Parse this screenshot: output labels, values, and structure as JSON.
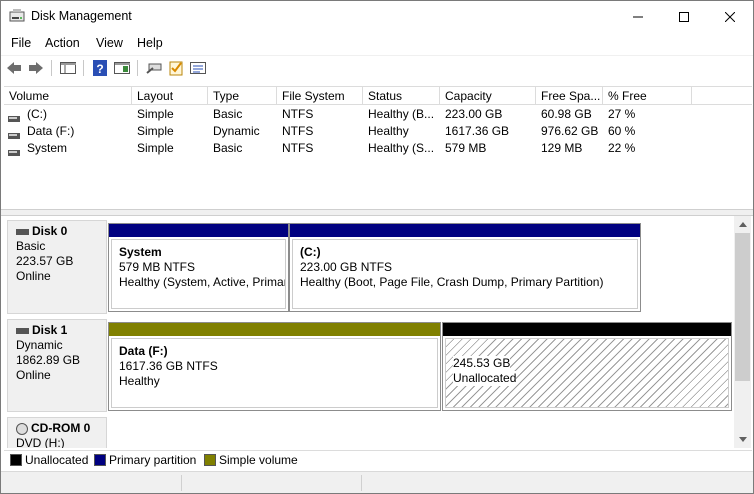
{
  "window": {
    "title": "Disk Management"
  },
  "menu": [
    "File",
    "Action",
    "View",
    "Help"
  ],
  "table": {
    "columns": [
      "Volume",
      "Layout",
      "Type",
      "File System",
      "Status",
      "Capacity",
      "Free Spa...",
      "% Free"
    ],
    "rows": [
      [
        "(C:)",
        "Simple",
        "Basic",
        "NTFS",
        "Healthy (B...",
        "223.00 GB",
        "60.98 GB",
        "27 %"
      ],
      [
        "Data (F:)",
        "Simple",
        "Dynamic",
        "NTFS",
        "Healthy",
        "1617.36 GB",
        "976.62 GB",
        "60 %"
      ],
      [
        "System",
        "Simple",
        "Basic",
        "NTFS",
        "Healthy (S...",
        "579 MB",
        "129 MB",
        "22 %"
      ]
    ]
  },
  "disks": [
    {
      "name": "Disk 0",
      "type": "Basic",
      "size": "223.57 GB",
      "state": "Online",
      "partitions": [
        {
          "title": "System",
          "line2": "579 MB NTFS",
          "line3": "Healthy (System, Active, Primar"
        },
        {
          "title": "(C:)",
          "line2": "223.00 GB NTFS",
          "line3": "Healthy (Boot, Page File, Crash Dump, Primary Partition)"
        }
      ]
    },
    {
      "name": "Disk 1",
      "type": "Dynamic",
      "size": "1862.89 GB",
      "state": "Online",
      "partitions": [
        {
          "title": "Data  (F:)",
          "line2": "1617.36 GB NTFS",
          "line3": "Healthy"
        },
        {
          "title": "",
          "line2": "245.53 GB",
          "line3": "Unallocated"
        }
      ]
    },
    {
      "name": "CD-ROM 0",
      "type": "DVD (H:)"
    }
  ],
  "legend": [
    "Unallocated",
    "Primary partition",
    "Simple volume"
  ],
  "colors": {
    "unallocated": "#000000",
    "primary": "#000080",
    "simple": "#808000"
  }
}
